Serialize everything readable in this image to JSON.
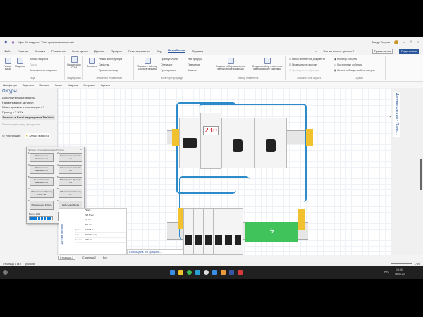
{
  "window": {
    "title": "Щит 06 модуля - Visio профессиональный",
    "user": "Тимур Петров",
    "comments": "Примечания",
    "share": "Поделиться"
  },
  "menu": [
    "Файл",
    "Главная",
    "Вставка",
    "Рисование",
    "Конструктор",
    "Данные",
    "Процесс",
    "Рецензирование",
    "Вид",
    "Разработчик",
    "Справка"
  ],
  "active_menu": "Разработчик",
  "search_hint": "Что вы хотите сделать?",
  "ribbon": {
    "code": {
      "items": [
        "Visual Basic",
        "Макросы",
        "Запись макроса",
        "Пауза",
        "Безопасность макросов"
      ],
      "caption": "Код"
    },
    "addins": {
      "items": [
        "Надстройки COM"
      ],
      "caption": "Надстройки"
    },
    "controls": {
      "items": [
        "Вставить",
        "Режим конструктора",
        "Свойства",
        "Просмотреть код"
      ],
      "caption": "Элементы управления"
    },
    "shape_design": {
      "items": [
        "Показать таблицу свойств фигуры",
        "Прямоугольник",
        "Операции",
        "Группировать",
        "Имя фигуры",
        "Поведение",
        "Защита"
      ],
      "caption": "Конструктор фигур"
    },
    "stencil": {
      "items": [
        "Создать набор элементов (метрические единицы)",
        "Создать набор элементов (американские единицы)"
      ],
      "caption": "Набор элементов"
    },
    "show": {
      "items": [
        "Набор элементов документа",
        "Проводник по рисунку",
        "Проводник по образцам"
      ],
      "caption": "Показать или скрыть"
    },
    "service": {
      "items": [
        "Монитор событий",
        "Постоянные события",
        "Печать таблицы свойств фигуры"
      ],
      "caption": "Сервис"
    }
  },
  "qat": [
    "Имя фигуры",
    "Выделить",
    "Заливка",
    "Линия",
    "Макросы",
    "Операции",
    "Удалить"
  ],
  "shapes_panel": {
    "title": "Фигуры",
    "items": [
      "Дополнительные фигуры",
      "Наименование, артикул",
      "Шины нулевые и контакторы v.2",
      "Провод v.7 ЖКХ",
      "Экспорт в Excel маркировки TimVisio"
    ],
    "hint": "Перетащите сюда фигуры из ...",
    "tools": [
      "Инструкция",
      "Запуск макроса"
    ]
  },
  "dialog": {
    "title": "Экспорт в Excel маркировки TimVisio",
    "buttons": [
      {
        "n": "1",
        "label": "Обозначение Наклейки v.1"
      },
      {
        "n": "2",
        "label": "Нанесение Наклейки v.1"
      },
      {
        "n": "3",
        "label": "Обозначение Наклейки v.2"
      },
      {
        "n": "4",
        "label": "Нанесение Наклейки v.2"
      },
      {
        "n": "5",
        "label": "Переключатель Наклейки v.3"
      },
      {
        "n": "6",
        "label": "Маркировка Провода v.4"
      },
      {
        "n": "7",
        "label": "Обозначение Провод + 801.1Е"
      },
      {
        "n": "8",
        "label": "Обозначение Провод v.7"
      },
      {
        "n": "9",
        "label": "Обозначение Кабель"
      },
      {
        "n": "10",
        "label": "Кабельная бирка"
      }
    ],
    "count_label": "Всего: 1935",
    "progress": 1.0,
    "exit": "Выход"
  },
  "shape_data": {
    "title": "Данные фигуры",
    "rows": [
      [
        "",
        "79 мм"
      ],
      [
        "",
        "218,5 мм"
      ],
      [
        "",
        "2,5 мм"
      ],
      [
        "",
        "800 мм"
      ],
      [
        "Длина",
        "0,0608 м"
      ],
      [
        "Угол",
        "90,0777 град"
      ],
      [
        "Высота",
        "92,5 мм"
      ]
    ]
  },
  "navigator": "Проводник по докуме...",
  "right_panel": "Данные фигуры - Прово...",
  "display": "230",
  "pages": [
    "Страница-1",
    "Страница-2",
    "Все"
  ],
  "status": {
    "page": "Страница 1 из 2",
    "lang": "русский",
    "zoom": "74%"
  },
  "taskbar": {
    "lang": "РУС",
    "time": "19:00",
    "date": "06.08.23"
  },
  "colors": {
    "accent": "#2b579a",
    "wire_blue": "#2e8bc9",
    "rail_yellow": "#f2c12e",
    "green": "#3fc35a"
  }
}
